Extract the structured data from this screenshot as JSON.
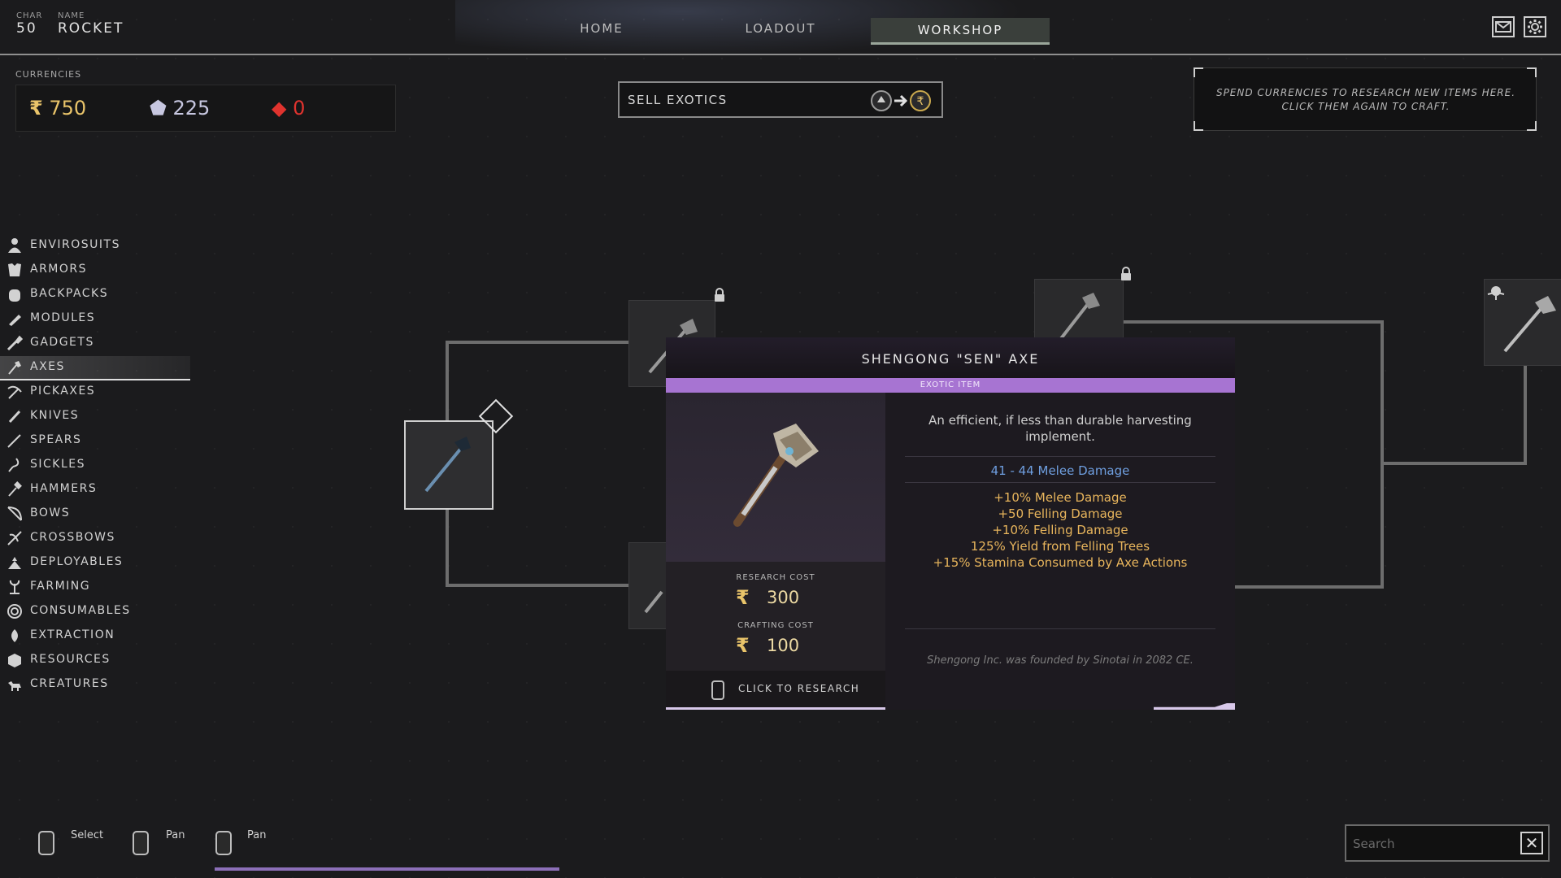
{
  "header": {
    "char_label": "CHAR",
    "char_value": "50",
    "name_label": "NAME",
    "name_value": "ROCKET",
    "tabs": [
      {
        "label": "HOME"
      },
      {
        "label": "LOADOUT"
      },
      {
        "label": "WORKSHOP",
        "active": true
      }
    ],
    "icons": [
      "mail-icon",
      "settings-gear-icon"
    ]
  },
  "currencies": {
    "label": "CURRENCIES",
    "items": [
      {
        "icon": "rupee-coin-icon",
        "value": "750",
        "color": "#e9c46a"
      },
      {
        "icon": "shard-icon",
        "value": "225",
        "color": "#c7c7e0"
      },
      {
        "icon": "exotic-crystal-icon",
        "value": "0",
        "color": "#e0332e"
      }
    ]
  },
  "sell": {
    "label": "SELL EXOTICS",
    "icon": "exotic-to-coin-icon"
  },
  "info": {
    "text": "SPEND CURRENCIES TO RESEARCH NEW ITEMS HERE. CLICK THEM AGAIN TO CRAFT."
  },
  "sidebar": {
    "items": [
      {
        "label": "ENVIROSUITS",
        "icon": "person-icon"
      },
      {
        "label": "ARMORS",
        "icon": "armor-icon"
      },
      {
        "label": "BACKPACKS",
        "icon": "backpack-icon"
      },
      {
        "label": "MODULES",
        "icon": "module-icon"
      },
      {
        "label": "GADGETS",
        "icon": "gadget-icon"
      },
      {
        "label": "AXES",
        "icon": "axe-icon",
        "active": true
      },
      {
        "label": "PICKAXES",
        "icon": "pickaxe-icon"
      },
      {
        "label": "KNIVES",
        "icon": "knife-icon"
      },
      {
        "label": "SPEARS",
        "icon": "spear-icon"
      },
      {
        "label": "SICKLES",
        "icon": "sickle-icon"
      },
      {
        "label": "HAMMERS",
        "icon": "hammer-icon"
      },
      {
        "label": "BOWS",
        "icon": "bow-icon"
      },
      {
        "label": "CROSSBOWS",
        "icon": "crossbow-icon"
      },
      {
        "label": "DEPLOYABLES",
        "icon": "deployable-icon"
      },
      {
        "label": "FARMING",
        "icon": "farming-icon"
      },
      {
        "label": "CONSUMABLES",
        "icon": "consumable-icon"
      },
      {
        "label": "EXTRACTION",
        "icon": "extraction-icon"
      },
      {
        "label": "RESOURCES",
        "icon": "resources-icon"
      },
      {
        "label": "CREATURES",
        "icon": "creature-icon"
      }
    ]
  },
  "tooltip": {
    "title": "SHENGONG \"SEN\" AXE",
    "rarity": "EXOTIC ITEM",
    "rarity_color": "#a774d2",
    "description": "An efficient, if less than durable harvesting implement.",
    "damage": "41 - 44 Melee Damage",
    "stats": [
      "+10% Melee Damage",
      "+50 Felling Damage",
      "+10% Felling Damage",
      "125% Yield from Felling Trees",
      "+15% Stamina Consumed by Axe Actions"
    ],
    "research_cost_label": "RESEARCH COST",
    "research_cost": "300",
    "crafting_cost_label": "CRAFTING COST",
    "crafting_cost": "100",
    "action": "CLICK TO RESEARCH",
    "lore": "Shengong Inc. was founded by Sinotai in 2082 CE."
  },
  "controls": {
    "hints": [
      {
        "label": "Select",
        "icon": "mouse-left-icon"
      },
      {
        "label": "Pan",
        "icon": "mouse-right-icon"
      },
      {
        "label": "Pan",
        "icon": "mouse-scroll-icon"
      }
    ]
  },
  "search": {
    "placeholder": "Search"
  }
}
